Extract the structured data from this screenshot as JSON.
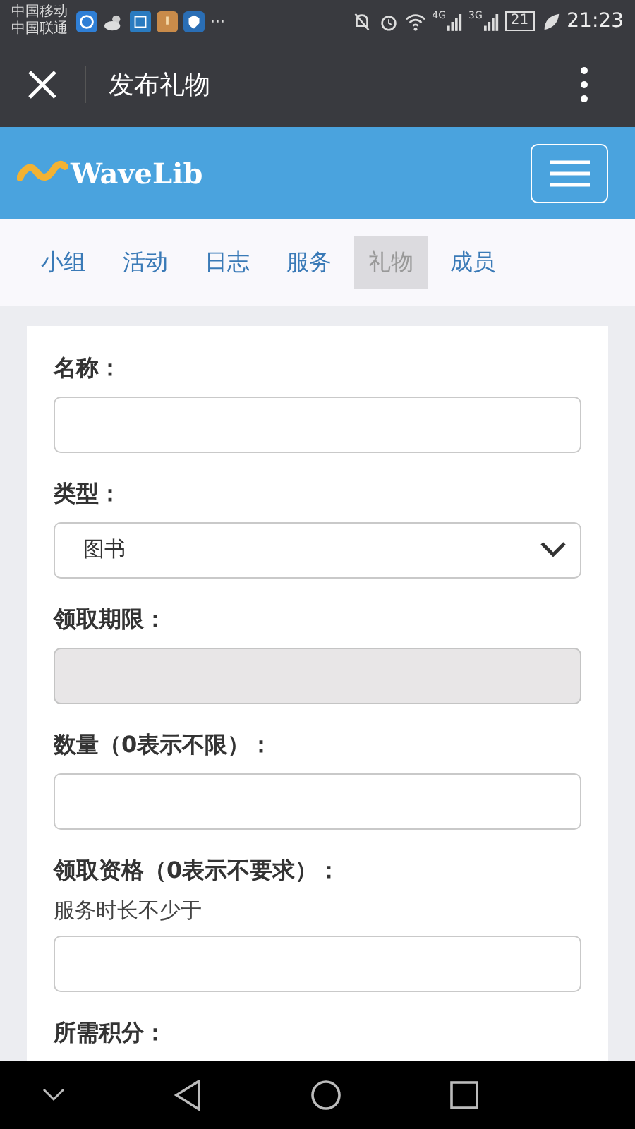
{
  "status_bar": {
    "carriers": [
      "中国移动",
      "中国联通"
    ],
    "overflow": "···",
    "networks": [
      "4G",
      "3G"
    ],
    "battery": "21",
    "time": "21:23"
  },
  "toolbar": {
    "title": "发布礼物"
  },
  "header": {
    "logo": "WaveLib"
  },
  "tabs": [
    {
      "label": "小组",
      "selected": false
    },
    {
      "label": "活动",
      "selected": false
    },
    {
      "label": "日志",
      "selected": false
    },
    {
      "label": "服务",
      "selected": false
    },
    {
      "label": "礼物",
      "selected": true
    },
    {
      "label": "成员",
      "selected": false
    }
  ],
  "form": [
    {
      "kind": "text",
      "label": "名称：",
      "disabled": false
    },
    {
      "kind": "select",
      "label": "类型：",
      "value": "图书"
    },
    {
      "kind": "text",
      "label": "领取期限：",
      "disabled": true
    },
    {
      "kind": "text",
      "label": "数量（0表示不限）：",
      "disabled": false
    },
    {
      "kind": "text",
      "label": "领取资格（0表示不要求）：",
      "hint": "服务时长不少于",
      "disabled": false
    },
    {
      "kind": "heading",
      "label": "所需积分："
    }
  ]
}
